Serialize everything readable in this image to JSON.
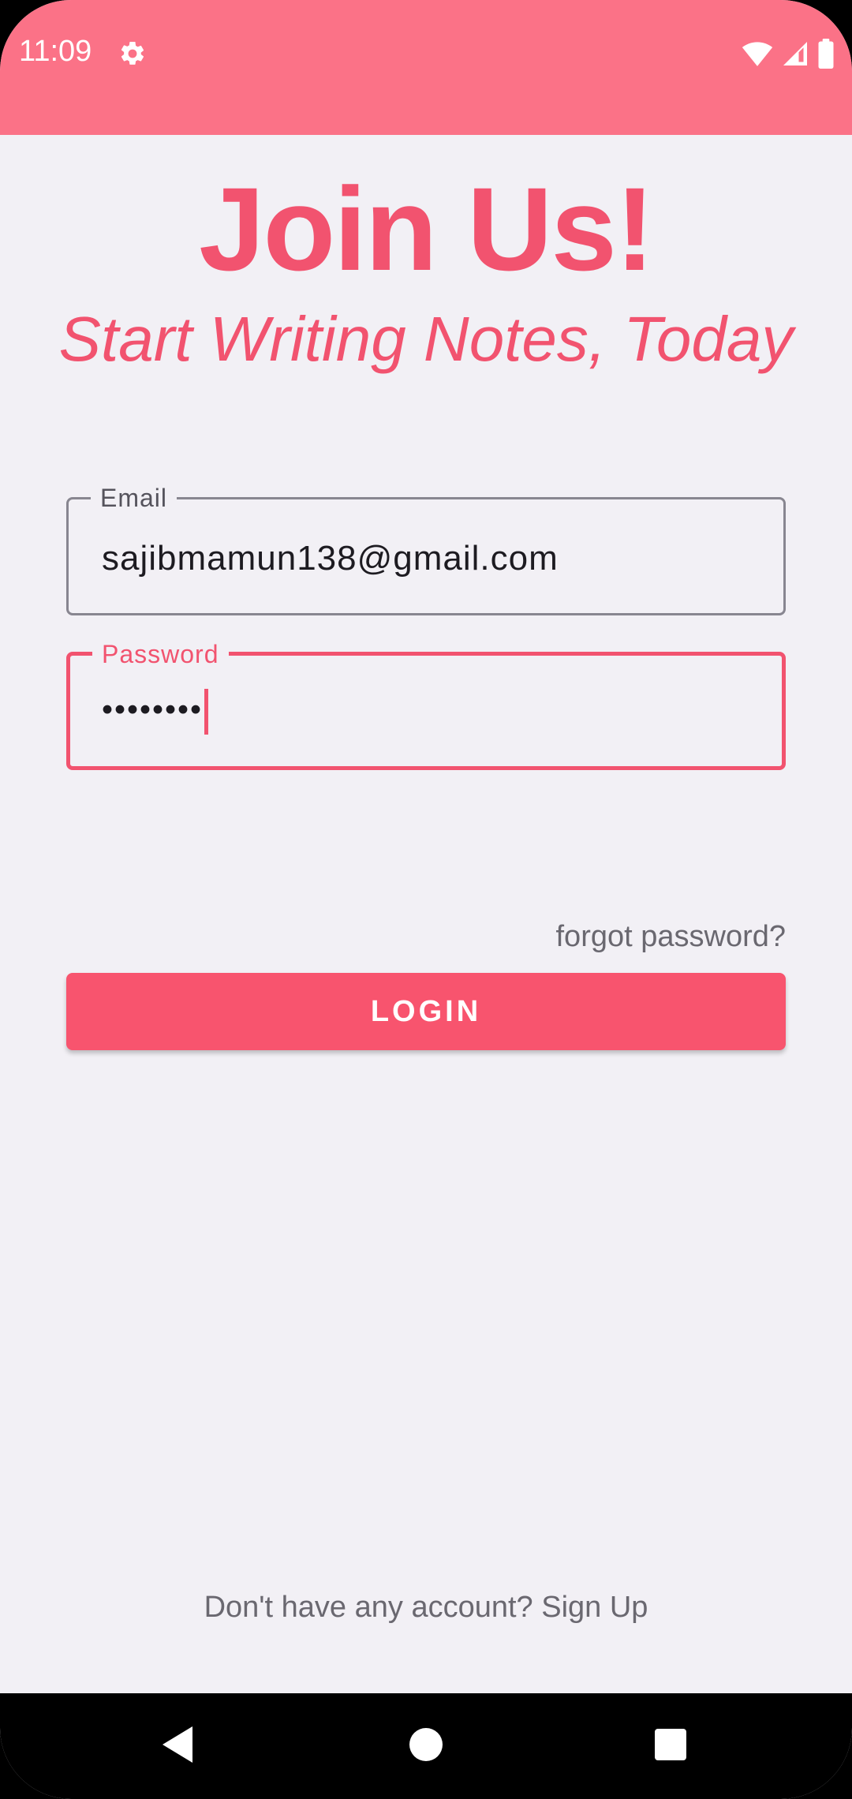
{
  "status_bar": {
    "time": "11:09",
    "icons": [
      "settings-gear-icon",
      "wifi-icon",
      "cell-signal-icon",
      "battery-icon"
    ],
    "background": "#fb7287"
  },
  "login": {
    "title": "Join Us!",
    "subtitle": "Start Writing Notes, Today",
    "email": {
      "label": "Email",
      "value": "sajibmamun138@gmail.com"
    },
    "password": {
      "label": "Password",
      "value": "••••••••"
    },
    "forgot_password": "forgot password?",
    "login_button": "LOGIN",
    "signup_prompt": "Don't have any account? Sign Up"
  },
  "nav_bar": {
    "icons": [
      "back-icon",
      "home-icon",
      "recents-icon"
    ]
  },
  "colors": {
    "accent": "#f2536f",
    "button": "#f8546e",
    "background": "#f2f0f5"
  }
}
